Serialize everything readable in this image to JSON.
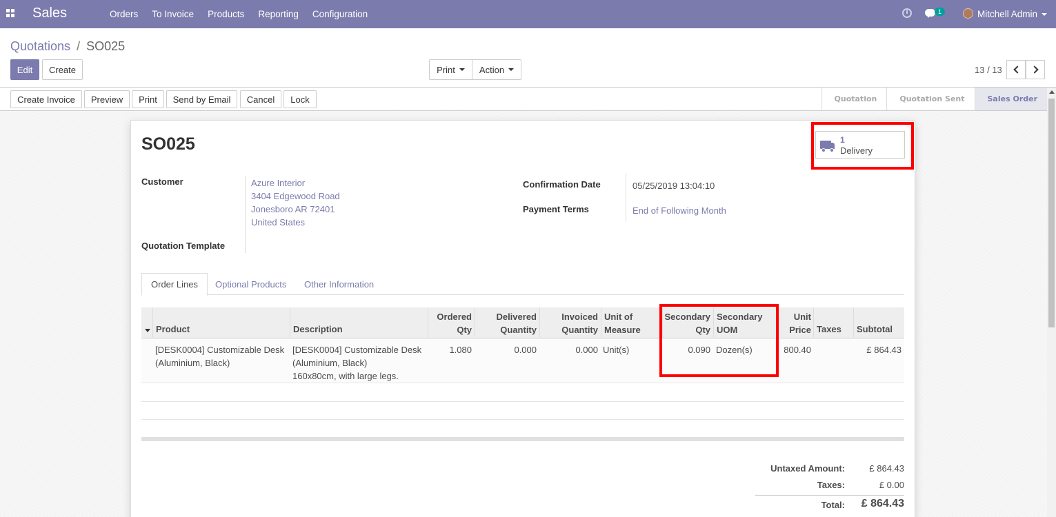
{
  "navbar": {
    "app_name": "Sales",
    "menu": [
      "Orders",
      "To Invoice",
      "Products",
      "Reporting",
      "Configuration"
    ],
    "chat_count": "1",
    "user": "Mitchell Admin"
  },
  "breadcrumb": {
    "parent": "Quotations",
    "separator": "/",
    "current": "SO025"
  },
  "buttons": {
    "edit": "Edit",
    "create": "Create",
    "print": "Print",
    "action": "Action"
  },
  "pager": {
    "text": "13 / 13"
  },
  "header_buttons": {
    "create_invoice": "Create Invoice",
    "preview": "Preview",
    "print": "Print",
    "send_by_email": "Send by Email",
    "cancel": "Cancel",
    "lock": "Lock"
  },
  "stages": [
    "Quotation",
    "Quotation Sent",
    "Sales Order"
  ],
  "active_stage": "Sales Order",
  "smart_button": {
    "count": "1",
    "label": "Delivery"
  },
  "order": {
    "name": "SO025",
    "customer_label": "Customer",
    "customer_lines": [
      "Azure Interior",
      "3404 Edgewood Road",
      "Jonesboro AR 72401",
      "United States"
    ],
    "quotation_template_label": "Quotation Template",
    "confirmation_date_label": "Confirmation Date",
    "confirmation_date": "05/25/2019 13:04:10",
    "payment_terms_label": "Payment Terms",
    "payment_terms": "End of Following Month"
  },
  "tabs": [
    "Order Lines",
    "Optional Products",
    "Other Information"
  ],
  "columns": {
    "product": "Product",
    "description": "Description",
    "ordered_qty": [
      "Ordered",
      "Qty"
    ],
    "delivered_qty": [
      "Delivered",
      "Quantity"
    ],
    "invoiced_qty": [
      "Invoiced",
      "Quantity"
    ],
    "uom": [
      "Unit of",
      "Measure"
    ],
    "secondary_qty": [
      "Secondary",
      "Qty"
    ],
    "secondary_uom": [
      "Secondary",
      "UOM"
    ],
    "unit_price": [
      "Unit",
      "Price"
    ],
    "taxes": "Taxes",
    "subtotal": "Subtotal"
  },
  "lines": [
    {
      "product": [
        "[DESK0004] Customizable Desk",
        "(Aluminium, Black)"
      ],
      "description": [
        "[DESK0004] Customizable Desk",
        "(Aluminium, Black)",
        "160x80cm, with large legs."
      ],
      "ordered_qty": "1.080",
      "delivered_qty": "0.000",
      "invoiced_qty": "0.000",
      "uom": "Unit(s)",
      "secondary_qty": "0.090",
      "secondary_uom": "Dozen(s)",
      "unit_price": "800.40",
      "taxes": "",
      "subtotal": "£ 864.43"
    }
  ],
  "totals": {
    "untaxed_label": "Untaxed Amount:",
    "untaxed": "£ 864.43",
    "taxes_label": "Taxes:",
    "taxes": "£ 0.00",
    "total_label": "Total:",
    "total": "£ 864.43"
  },
  "colors": {
    "brand": "#7c7bad",
    "highlight": "#ff0000"
  }
}
